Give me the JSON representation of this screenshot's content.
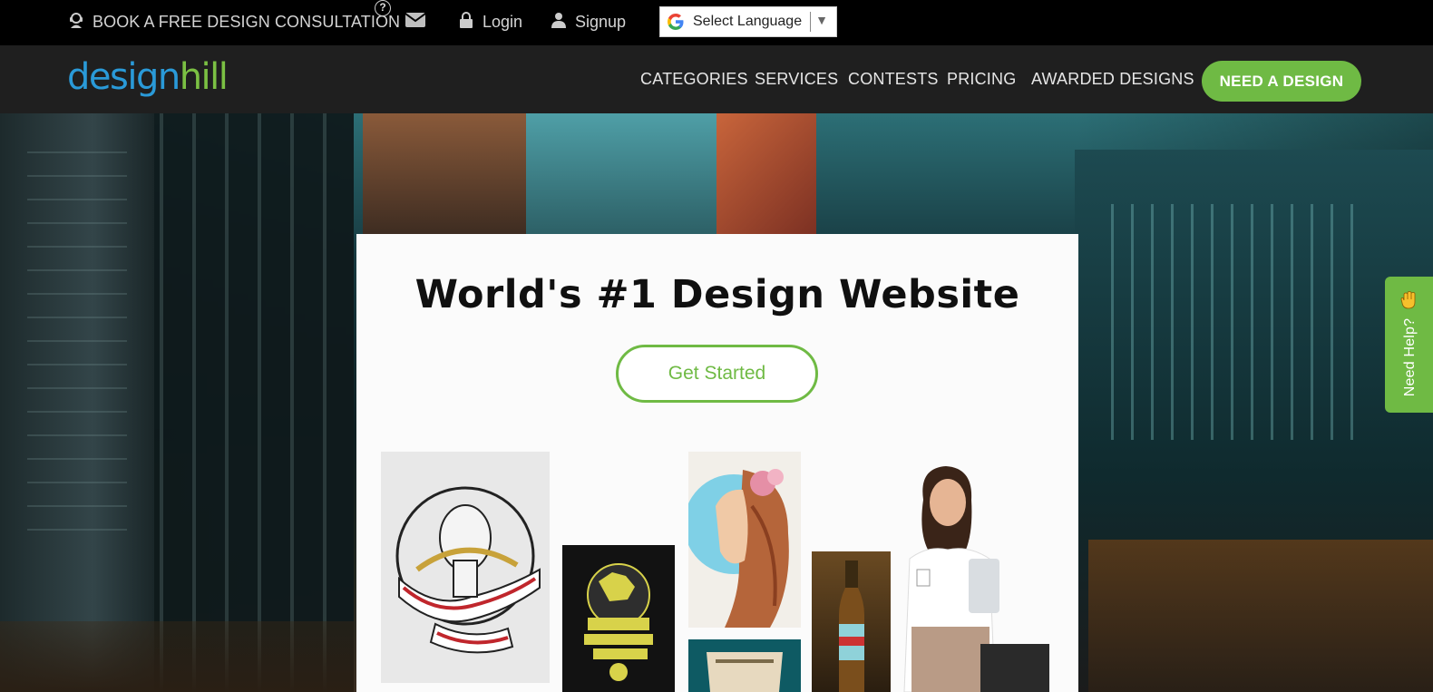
{
  "topbar": {
    "consultation_label": "BOOK A FREE DESIGN CONSULTATION",
    "help_badge": "?",
    "login_label": "Login",
    "signup_label": "Signup",
    "language_select_label": "Select Language"
  },
  "header": {
    "logo_part1": "design",
    "logo_part2": "hill",
    "nav": [
      "CATEGORIES",
      "SERVICES",
      "CONTESTS",
      "PRICING",
      "AWARDED DESIGNS"
    ],
    "cta_label": "NEED A DESIGN"
  },
  "hero": {
    "title": "World's #1 Design Website",
    "cta_label": "Get Started"
  },
  "help_tab": {
    "label": "Need Help?"
  },
  "colors": {
    "brand_green": "#6fba44",
    "brand_blue": "#2a9ad8",
    "header_bg": "#1f1f1f",
    "topbar_bg": "#000000"
  }
}
